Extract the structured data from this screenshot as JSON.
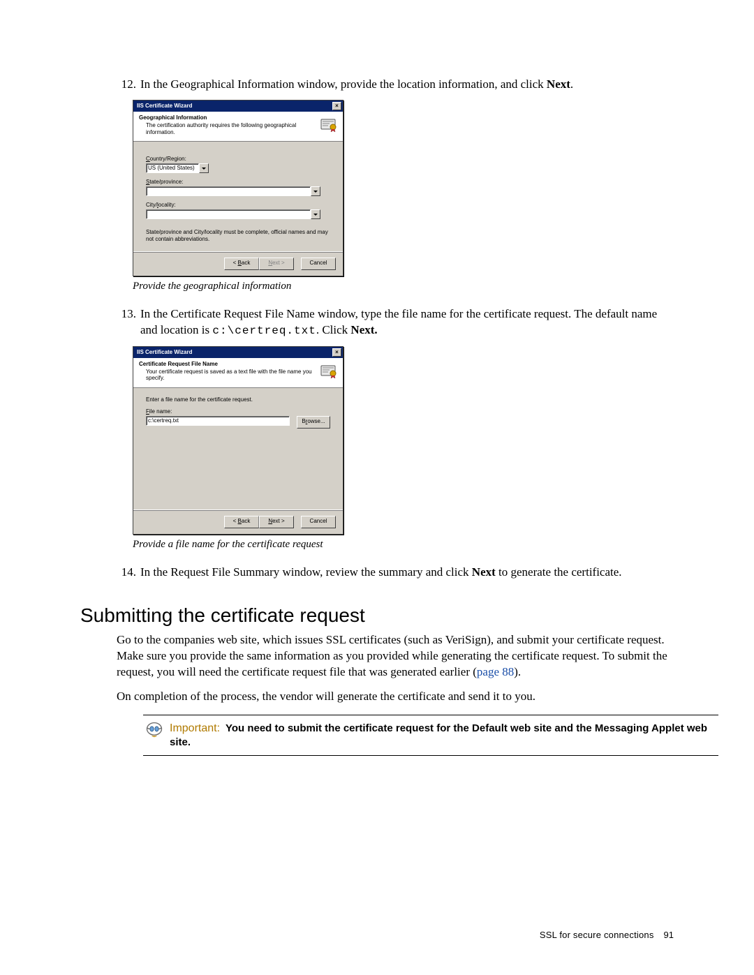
{
  "steps": {
    "s12": {
      "num": "12.",
      "text_a": "In the Geographical Information window, provide the location information, and click ",
      "text_b": "Next",
      "text_c": "."
    },
    "s13": {
      "num": "13.",
      "text_a": "In the Certificate Request File Name window, type the file name for the certificate request. The default name and location is ",
      "code": "c:\\certreq.txt",
      "text_b": ". Click ",
      "text_c": "Next.",
      "text_d": ""
    },
    "s14": {
      "num": "14.",
      "text_a": "In the Request File Summary window, review the summary and click ",
      "text_b": "Next",
      "text_c": " to generate the certificate."
    }
  },
  "captions": {
    "c1": "Provide the geographical information",
    "c2": "Provide a file name for the certificate request"
  },
  "wizard_common": {
    "title": "IIS Certificate Wizard",
    "btn_back_pre": "< ",
    "btn_back_u": "B",
    "btn_back_post": "ack",
    "btn_next_u": "N",
    "btn_next_post": "ext >",
    "btn_cancel": "Cancel",
    "close_x": "×"
  },
  "wizard1": {
    "htitle": "Geographical Information",
    "hsub": "The certification authority requires the following geographical information.",
    "country_label_u": "C",
    "country_label_post": "ountry/Region:",
    "country_value": "US (United States)",
    "state_label_u": "S",
    "state_label_post": "tate/province:",
    "city_label_pre": "City/",
    "city_label_u": "l",
    "city_label_post": "ocality:",
    "note": "State/province and City/locality must be complete, official names and may not contain abbreviations."
  },
  "wizard2": {
    "htitle": "Certificate Request File Name",
    "hsub": "Your certificate request is saved as a text file with the file name you specify.",
    "instr": "Enter a file name for the certificate request.",
    "file_label_u": "F",
    "file_label_post": "ile name:",
    "file_value": "c:\\certreq.txt",
    "browse_pre": "B",
    "browse_u": "r",
    "browse_post": "owse..."
  },
  "section": {
    "title": "Submitting the certificate request",
    "p1_a": "Go to the companies web site, which issues SSL certificates (such as VeriSign), and submit your certificate request. Make sure you provide the same information as you provided while generating the certificate request. To submit the request, you will need the certificate request file that was generated earlier (",
    "p1_link": "page 88",
    "p1_b": ").",
    "p2": "On completion of the process, the vendor will generate the certificate and send it to you."
  },
  "important": {
    "label": "Important:",
    "text": "You need to submit the certificate request for the Default web site and the Messaging Applet web site."
  },
  "footer": {
    "section": "SSL for secure connections",
    "page": "91"
  }
}
